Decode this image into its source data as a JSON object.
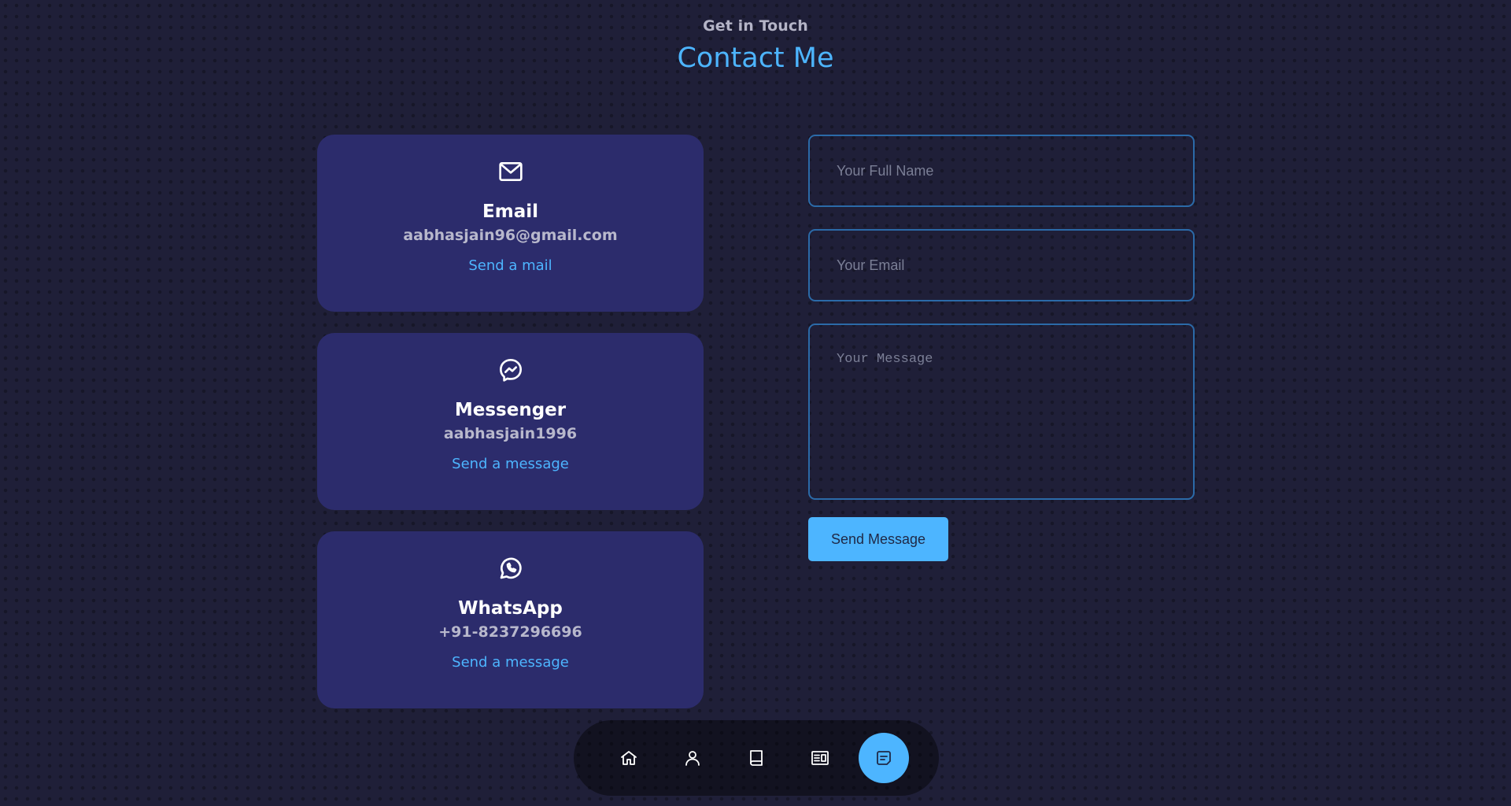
{
  "header": {
    "subtitle": "Get in Touch",
    "title": "Contact Me"
  },
  "contact_options": [
    {
      "icon": "mail-icon",
      "title": "Email",
      "value": "aabhasjain96@gmail.com",
      "link_label": "Send a mail"
    },
    {
      "icon": "messenger-icon",
      "title": "Messenger",
      "value": "aabhasjain1996",
      "link_label": "Send a message"
    },
    {
      "icon": "whatsapp-icon",
      "title": "WhatsApp",
      "value": "+91-8237296696",
      "link_label": "Send a message"
    }
  ],
  "form": {
    "name_placeholder": "Your Full Name",
    "email_placeholder": "Your Email",
    "message_placeholder": "Your Message",
    "submit_label": "Send Message"
  },
  "nav": {
    "items": [
      {
        "icon": "home-icon",
        "active": false
      },
      {
        "icon": "user-icon",
        "active": false
      },
      {
        "icon": "book-icon",
        "active": false
      },
      {
        "icon": "services-icon",
        "active": false
      },
      {
        "icon": "message-icon",
        "active": true
      }
    ]
  },
  "colors": {
    "accent": "#4db5ff",
    "card_bg": "#2c2c6c",
    "page_bg": "#1f1f38",
    "input_border": "#2b6aa8"
  }
}
